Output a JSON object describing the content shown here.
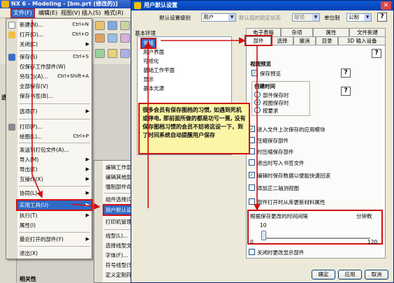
{
  "app": {
    "title": "NX 6 - Modeling - [bm.prt (修改的)]"
  },
  "menubar": {
    "file": "文件(F)",
    "edit": "编辑(E)",
    "view": "视图(V)",
    "insert": "插入(S)",
    "format": "格式(R)"
  },
  "nav": {
    "label": "选择",
    "bottom_label": "相关性"
  },
  "file_menu": {
    "items": [
      {
        "label": "新建(N)...",
        "shortcut": "Ctrl+N"
      },
      {
        "label": "打开(O)...",
        "shortcut": "Ctrl+O"
      },
      {
        "label": "关闭(C)",
        "shortcut": ""
      },
      {
        "label": "保存(S)",
        "shortcut": "Ctrl+S"
      },
      {
        "label": "仅保存工作部件(W)",
        "shortcut": ""
      },
      {
        "label": "另存为(A)...",
        "shortcut": "Ctrl+Shift+A"
      },
      {
        "label": "全部保存(V)",
        "shortcut": ""
      },
      {
        "label": "保存书签(B)...",
        "shortcut": ""
      },
      {
        "label": "选项(T)",
        "shortcut": ""
      },
      {
        "label": "打印(P)...",
        "shortcut": ""
      },
      {
        "label": "绘图(L)...",
        "shortcut": "Ctrl+P"
      },
      {
        "label": "发送到打包文件(A)...",
        "shortcut": ""
      },
      {
        "label": "导入(M)",
        "shortcut": ""
      },
      {
        "label": "导出(E)",
        "shortcut": ""
      },
      {
        "label": "互操作(X)",
        "shortcut": ""
      },
      {
        "label": "协同(L)",
        "shortcut": ""
      },
      {
        "label": "实用工具(U)",
        "shortcut": ""
      },
      {
        "label": "执行(T)",
        "shortcut": ""
      },
      {
        "label": "属性(I)",
        "shortcut": ""
      },
      {
        "label": "最近打开的部件(Y)",
        "shortcut": ""
      },
      {
        "label": "退出(X)",
        "shortcut": ""
      }
    ]
  },
  "submenu": {
    "items": [
      {
        "label": "编辑工作部件文件头(W)..."
      },
      {
        "label": "编辑其他部件文件头(N)..."
      },
      {
        "label": "强制部件命令(F)..."
      },
      {
        "label": "组件选择(D)..."
      },
      {
        "label": "用户默认设置(D)..."
      },
      {
        "label": "打印机管理(P)..."
      },
      {
        "label": "线型(L)..."
      },
      {
        "label": "选择线型文件(E)..."
      },
      {
        "label": "字体(F)..."
      },
      {
        "label": "符号线型(S)..."
      },
      {
        "label": "定义定制符号(M)..."
      }
    ]
  },
  "dialog": {
    "title": "用户默认设置",
    "level_label": "默认设置级别",
    "level_value": "用户",
    "default_lock_label": "默认值的锁定状态",
    "lock_value": "解锁",
    "unit_label": "单位制",
    "unit_value": "公制",
    "tree_group": "基本环境",
    "tree": [
      "常规",
      "用户界面",
      "可视化",
      "基础工作平面",
      "显示",
      "基本光源"
    ],
    "tabs_row1": [
      "电子表格",
      "杂项",
      "属性",
      "文件新建"
    ],
    "tabs_row2": [
      "部件",
      "选择",
      "撤消",
      "目录",
      "3D 输入设备"
    ],
    "panel": {
      "preview_section": "视图预览",
      "preview_check": "保存预览",
      "create_section": "创建时间",
      "radio_part_save": "部件保存时",
      "radio_view_save": "视图保存时",
      "radio_on_demand": "按要求",
      "check_load_last_module": "进入文件上次保存的应用模块",
      "check_compress_save": "压缩保存部件",
      "check_compress_when": "时压缩保存部件",
      "check_exit_bookmark": "退出时写入书签文件",
      "check_save_quick": "编辑时保存数据以便能快速回滚",
      "check_auto_geometry": "添加正二轴测视图",
      "check_update_materials": "部件打开时从库更新材料属性",
      "autosave_label": "根据保存更改的时间间隔",
      "autosave_unit": "分钟数",
      "slider_value": "10",
      "slider_min": "0",
      "slider_max": "120",
      "check_close_modify": "关闭时更改显示部件"
    },
    "ok_button": "确定",
    "apply_button": "应用",
    "cancel_button": "取消"
  },
  "annotation": {
    "text": "很多会员有保存图档的习惯, 如遇到死机或停电, 那前面所做的都是功亏一篑, 没有保存图档习惯的会员不妨将这设一下，到了时间系统自动提醒用户保存"
  },
  "colors": {
    "highlight": "#316ac5",
    "annotation_border": "#d01010",
    "annotation_bg": "#fbf5a6",
    "title_bar": "#0a58d8"
  }
}
